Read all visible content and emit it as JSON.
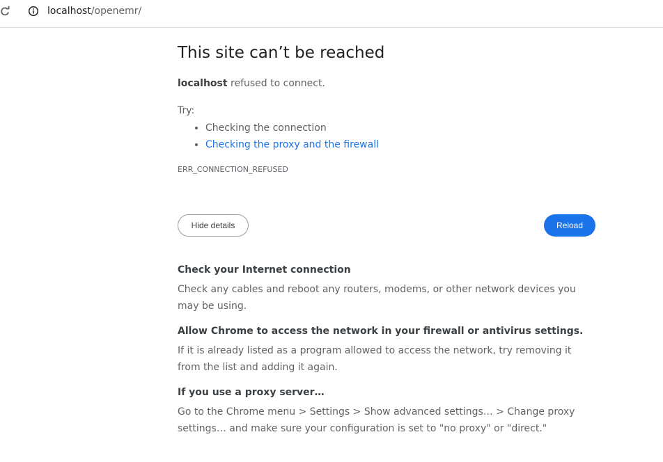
{
  "browser": {
    "url_host": "localhost",
    "url_path": "/openemr/"
  },
  "error_page": {
    "title": "This site can’t be reached",
    "host": "localhost",
    "summary_suffix": " refused to connect.",
    "try_label": "Try:",
    "suggestions": [
      "Checking the connection",
      "Checking the proxy and the firewall"
    ],
    "error_code": "ERR_CONNECTION_REFUSED",
    "hide_details_label": "Hide details",
    "reload_label": "Reload",
    "details": [
      {
        "heading": "Check your Internet connection",
        "body": "Check any cables and reboot any routers, modems, or other network devices you may be using."
      },
      {
        "heading": "Allow Chrome to access the network in your firewall or antivirus settings.",
        "body": "If it is already listed as a program allowed to access the network, try removing it from the list and adding it again."
      },
      {
        "heading": "If you use a proxy server…",
        "body": "Go to the Chrome menu > Settings > Show advanced settings… > Change proxy settings… and make sure your configuration is set to \"no proxy\" or \"direct.\""
      }
    ]
  },
  "colors": {
    "link": "#1a73e8",
    "primary_button": "#1a73e8",
    "text": "#5f6368",
    "heading": "#202124"
  }
}
